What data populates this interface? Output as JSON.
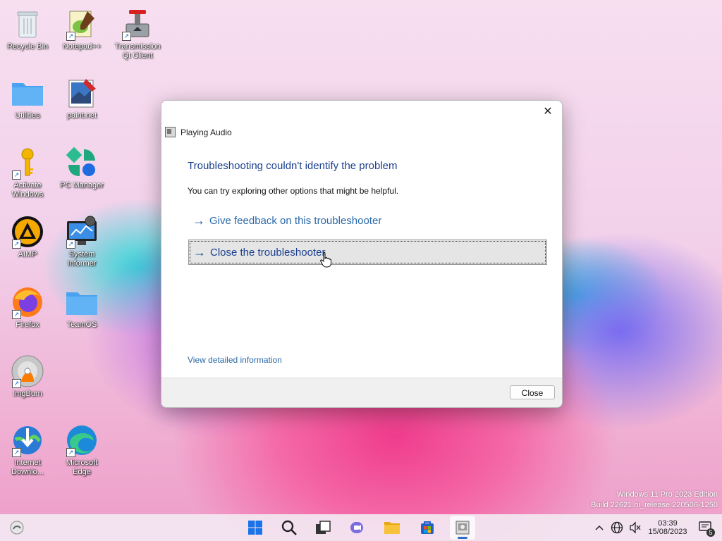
{
  "desktop": {
    "icons": [
      {
        "label": "Recycle Bin"
      },
      {
        "label": "Notepad++"
      },
      {
        "label": "Transmission Qt Client"
      },
      {
        "label": "Utilities"
      },
      {
        "label": "paint.net"
      },
      {
        "label": "Activate Windows"
      },
      {
        "label": "PC Manager"
      },
      {
        "label": "AIMP"
      },
      {
        "label": "System Informer"
      },
      {
        "label": "Firefox"
      },
      {
        "label": "TeamOS"
      },
      {
        "label": "ImgBurn"
      },
      {
        "label": "Internet Downlo..."
      },
      {
        "label": "Microsoft Edge"
      }
    ]
  },
  "dialog": {
    "window_title": "Playing Audio",
    "heading": "Troubleshooting couldn't identify the problem",
    "subtext": "You can try exploring other options that might be helpful.",
    "options": [
      {
        "label": "Give feedback on this troubleshooter"
      },
      {
        "label": "Close the troubleshooter"
      }
    ],
    "detail_link": "View detailed information",
    "close_button": "Close"
  },
  "watermark": {
    "line1": "Windows 11 Pro 2023 Edition",
    "line2": "Build 22621.ni_release.220506-1250"
  },
  "taskbar": {
    "time": "03:39",
    "date": "15/08/2023",
    "notification_count": "5"
  },
  "colors": {
    "heading": "#1b3f8f",
    "link": "#2a6aa8",
    "taskbar_accent": "#2d6fc7"
  }
}
